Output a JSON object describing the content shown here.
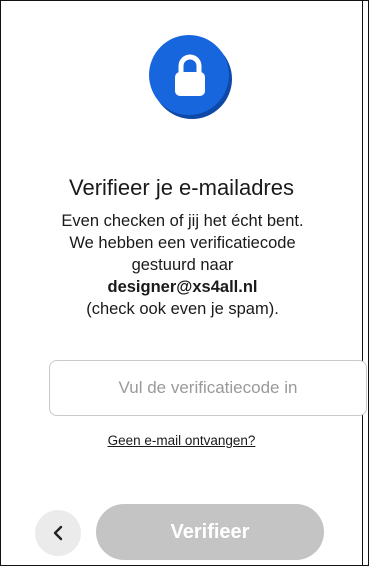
{
  "header": {
    "icon": "lock-icon",
    "title": "Verifieer je e-mailadres"
  },
  "description": {
    "line1": "Even checken of jij het écht bent.",
    "line2": "We hebben een verificatiecode",
    "line3": "gestuurd naar",
    "email": "designer@xs4all.nl",
    "line5": "(check ook even je spam)."
  },
  "form": {
    "code_placeholder": "Vul de verificatiecode in",
    "code_value": "",
    "no_mail_link": "Geen e-mail ontvangen?"
  },
  "footer": {
    "back_icon": "chevron-left-icon",
    "verify_label": "Verifieer"
  },
  "colors": {
    "accent": "#1766dd",
    "disabled_button": "#c4c4c4",
    "back_button_bg": "#ebebeb"
  }
}
